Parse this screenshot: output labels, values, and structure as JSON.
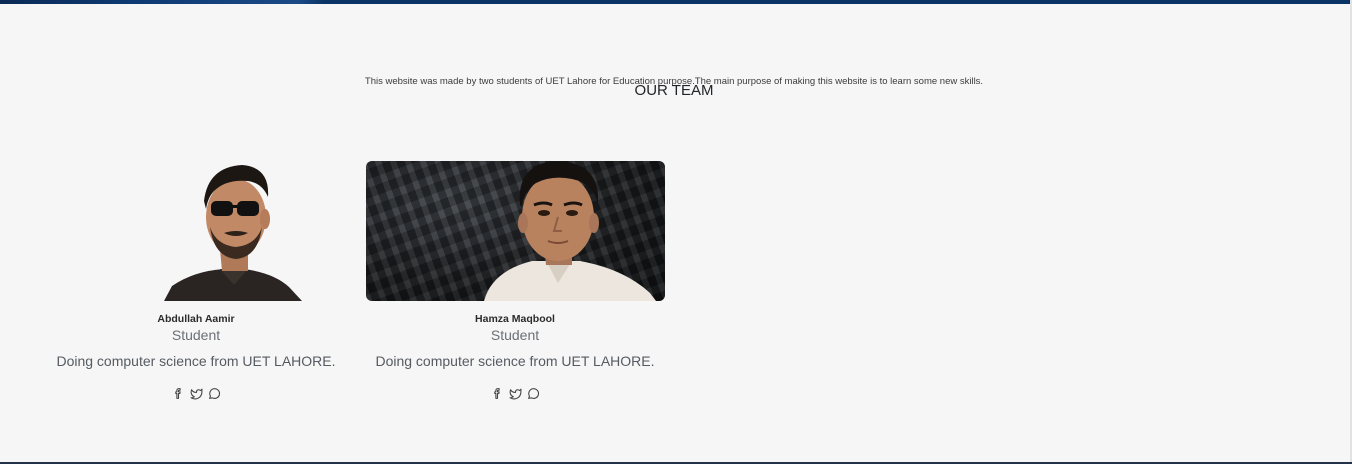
{
  "intro": {
    "text": "This website was made by two students of UET Lahore for Education purpose.The main purpose of making this website is to learn some new skills."
  },
  "team": {
    "heading": "OUR TEAM",
    "members": [
      {
        "name": "Abdullah Aamir",
        "role": "Student",
        "description": "Doing computer science from UET LAHORE.",
        "socials": [
          "facebook-icon",
          "twitter-icon",
          "whatsapp-icon"
        ]
      },
      {
        "name": "Hamza Maqbool",
        "role": "Student",
        "description": "Doing computer science from UET LAHORE.",
        "socials": [
          "facebook-icon",
          "twitter-icon",
          "whatsapp-icon"
        ]
      }
    ]
  },
  "colors": {
    "page_background": "#f6f6f6",
    "top_bar": "#0b3466",
    "text_muted": "#6b7075"
  }
}
